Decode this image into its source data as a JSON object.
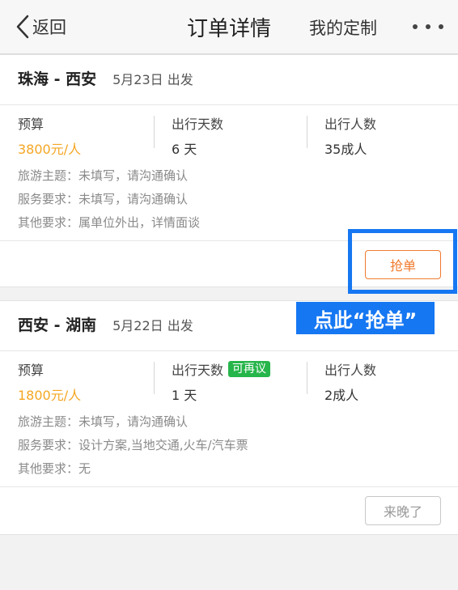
{
  "nav": {
    "back_label": "返回",
    "title": "订单详情",
    "right_label": "我的定制"
  },
  "orders": [
    {
      "route": "珠海 - 西安",
      "date": "5月23日 出发",
      "budget_label": "预算",
      "budget_value": "3800元/人",
      "days_label": "出行天数",
      "days_value": "6 天",
      "days_tag": "",
      "people_label": "出行人数",
      "people_value": "35成人",
      "theme": "旅游主题：未填写，请沟通确认",
      "service": "服务要求：未填写，请沟通确认",
      "other": "其他要求：属单位外出，详情面谈",
      "action_label": "抢单"
    },
    {
      "route": "西安 - 湖南",
      "date": "5月22日 出发",
      "budget_label": "预算",
      "budget_value": "1800元/人",
      "days_label": "出行天数",
      "days_value": "1 天",
      "days_tag": "可再议",
      "people_label": "出行人数",
      "people_value": "2成人",
      "theme": "旅游主题：未填写，请沟通确认",
      "service": "服务要求：设计方案,当地交通,火车/汽车票",
      "other": "其他要求：无",
      "action_label": "来晚了"
    }
  ],
  "annotation": {
    "callout_text": "点此“抢单”"
  },
  "colors": {
    "accent_orange": "#f07a2e",
    "price": "#f5a623",
    "tag_green": "#26b54a",
    "annotation_blue": "#1677f2"
  },
  "icons": {
    "back": "chevron-left-icon",
    "more": "more-dots-icon"
  }
}
